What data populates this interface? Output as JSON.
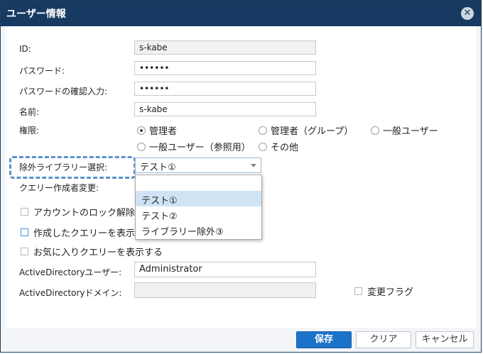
{
  "dialog": {
    "title": "ユーザー情報",
    "close_glyph": "✕"
  },
  "fields": {
    "id": {
      "label": "ID:",
      "value": "s-kabe"
    },
    "password": {
      "label": "パスワード:",
      "value": "••••••"
    },
    "password_confirm": {
      "label": "パスワードの確認入力:",
      "value": "••••••"
    },
    "name": {
      "label": "名前:",
      "value": "s-kabe"
    },
    "authority": {
      "label": "権限:",
      "options": [
        "管理者",
        "管理者（グループ）",
        "一般ユーザー",
        "一般ユーザー（参照用）",
        "その他"
      ],
      "selected": "管理者"
    },
    "exclude_library": {
      "label": "除外ライブラリー選択:",
      "value": "テスト①",
      "options": [
        "",
        "テスト①",
        "テスト②",
        "ライブラリー除外③"
      ]
    },
    "query_author_change": {
      "label": "クエリー作成者変更:"
    },
    "account_lock": {
      "label": "アカウントのロック解除"
    },
    "show_created_queries": {
      "label": "作成したクエリーを表示"
    },
    "show_favorite_queries": {
      "label": "お気に入りクエリーを表示する"
    },
    "ad_user": {
      "label": "ActiveDirectoryユーザー:",
      "value": "Administrator"
    },
    "ad_domain": {
      "label": "ActiveDirectoryドメイン:",
      "value": ""
    },
    "change_flag": {
      "label": "変更フラグ"
    }
  },
  "buttons": {
    "save": "保存",
    "clear": "クリア",
    "cancel": "キャンセル"
  },
  "colors": {
    "titlebar": "#173a62",
    "primary": "#1a73c9",
    "highlight": "#5b92c9"
  }
}
